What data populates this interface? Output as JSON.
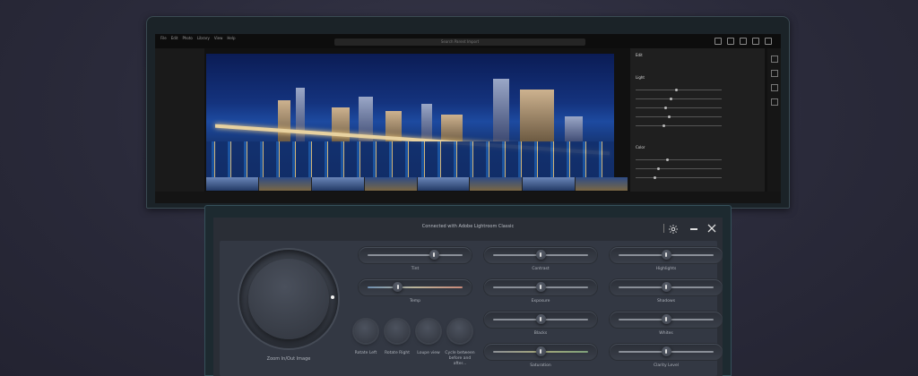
{
  "lightroom": {
    "search_placeholder": "Search Parent Import",
    "menu": [
      "File",
      "Edit",
      "Photo",
      "Library",
      "View",
      "Help"
    ],
    "panel_title": "Edit",
    "panel_light": "Light",
    "panel_color": "Color"
  },
  "screenpad": {
    "title": "Connected with Adobe Lightroom Classic",
    "zoom_label": "Zoom In/Out Image",
    "buttons": [
      {
        "label": "Rotate Left"
      },
      {
        "label": "Rotate Right"
      },
      {
        "label": "Loupe view"
      },
      {
        "label": "Cycle between before and after..."
      }
    ],
    "sliders": [
      {
        "label": "Tint",
        "value": 0.7
      },
      {
        "label": "Temp",
        "value": 0.32
      },
      {
        "label": "Contrast",
        "value": 0.5
      },
      {
        "label": "Exposure",
        "value": 0.5
      },
      {
        "label": "Blacks",
        "value": 0.5
      },
      {
        "label": "Saturation",
        "value": 0.5
      },
      {
        "label": "Highlights",
        "value": 0.5
      },
      {
        "label": "Shadows",
        "value": 0.5
      },
      {
        "label": "Whites",
        "value": 0.5
      },
      {
        "label": "Clarity Level",
        "value": 0.5
      }
    ]
  }
}
